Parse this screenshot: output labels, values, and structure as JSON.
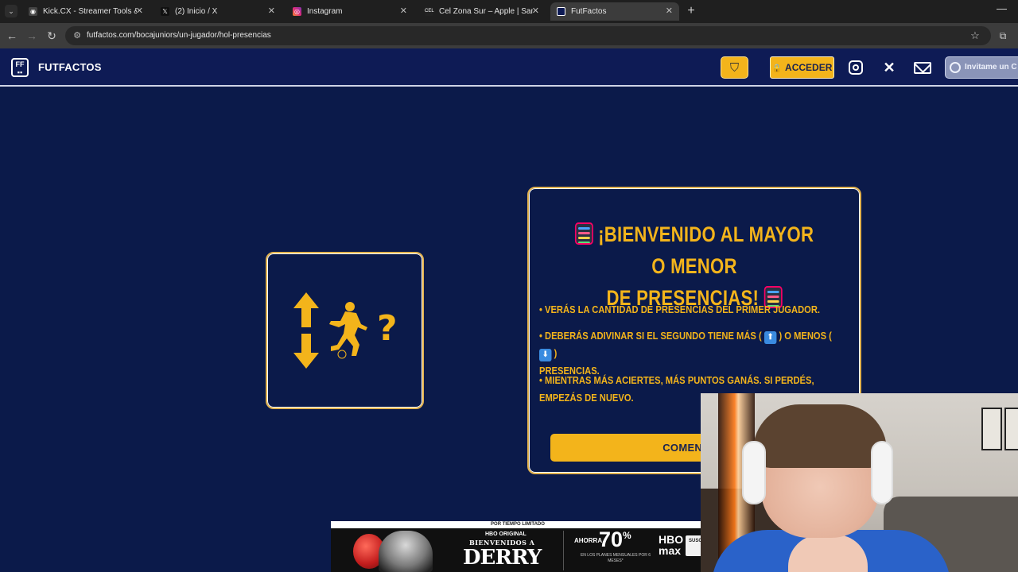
{
  "browser": {
    "tabs": [
      {
        "title": "Kick.CX - Streamer Tools & Cha",
        "favicon": "kick-cx-favicon",
        "active": false
      },
      {
        "title": "(2) Inicio / X",
        "favicon": "x-favicon",
        "active": false
      },
      {
        "title": "Instagram",
        "favicon": "instagram-favicon",
        "active": false
      },
      {
        "title": "Cel Zona Sur – Apple | Samsung",
        "favicon": "celzona-favicon",
        "active": false
      },
      {
        "title": "FutFactos",
        "favicon": "futfactos-favicon",
        "active": true
      }
    ],
    "url": "futfactos.com/bocajuniors/un-jugador/hol-presencias"
  },
  "site": {
    "brand": "FUTFACTOS",
    "login_label": "ACCEDER",
    "coffee_label": "Invitame un C",
    "accent": "#f3b41b",
    "background": "#0b1a4a"
  },
  "game": {
    "welcome_line1": "¡BIENVENIDO AL MAYOR O MENOR",
    "welcome_line2": "DE PRESENCIAS!",
    "rule1": "• VERÁS LA CANTIDAD DE PRESENCIAS DEL PRIMER JUGADOR.",
    "rule2_a": "• DEBERÁS ADIVINAR SI EL SEGUNDO TIENE MÁS (",
    "rule2_b": ") O MENOS (",
    "rule2_c": ")",
    "rule2_d": "PRESENCIAS.",
    "rule3": "• MIENTRAS MÁS ACIERTES, MÁS PUNTOS GANÁS. SI PERDÉS, EMPEZÁS DE NUEVO.",
    "start_label": "COMENZAR",
    "question_mark": "?"
  },
  "ad": {
    "top_text": "POR TIEMPO LIMITADO",
    "hbo_original": "HBO ORIGINAL",
    "title_small": "BIENVENIDOS A",
    "title_big": "DERRY",
    "save_text": "AHORRA",
    "percent": "70",
    "percent_sign": "%",
    "fine_print": "EN LOS PLANES MENSUALES POR 6 MESES*",
    "brand": "HBO max",
    "subscribe": "SUSC A"
  }
}
